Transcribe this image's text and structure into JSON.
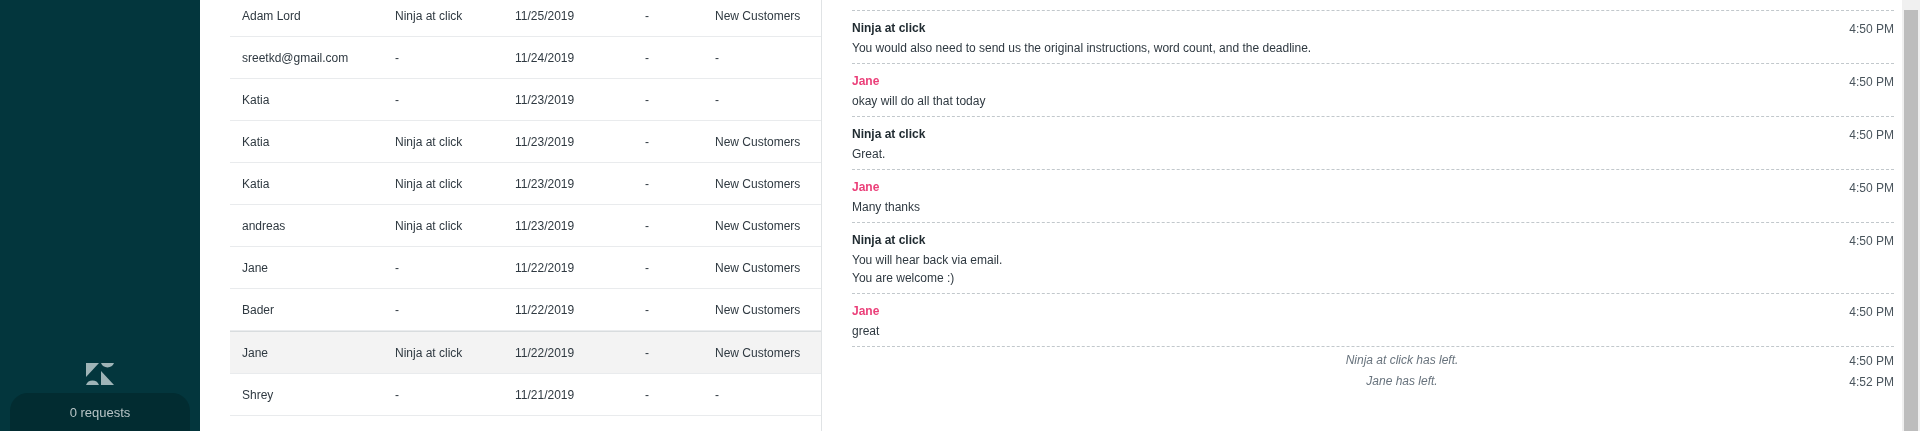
{
  "sidebar": {
    "requests_button": "0 requests"
  },
  "table": {
    "rows": [
      {
        "cells": [
          "Adam Lord",
          "Ninja at click",
          "11/25/2019",
          "-",
          "New Customers"
        ],
        "selected": false
      },
      {
        "cells": [
          "sreetkd@gmail.com",
          "-",
          "11/24/2019",
          "-",
          "-"
        ],
        "selected": false
      },
      {
        "cells": [
          "Katia",
          "-",
          "11/23/2019",
          "-",
          "-"
        ],
        "selected": false
      },
      {
        "cells": [
          "Katia",
          "Ninja at click",
          "11/23/2019",
          "-",
          "New Customers"
        ],
        "selected": false
      },
      {
        "cells": [
          "Katia",
          "Ninja at click",
          "11/23/2019",
          "-",
          "New Customers"
        ],
        "selected": false
      },
      {
        "cells": [
          "andreas",
          "Ninja at click",
          "11/23/2019",
          "-",
          "New Customers"
        ],
        "selected": false
      },
      {
        "cells": [
          "Jane",
          "-",
          "11/22/2019",
          "-",
          "New Customers"
        ],
        "selected": false
      },
      {
        "cells": [
          "Bader",
          "-",
          "11/22/2019",
          "-",
          "New Customers"
        ],
        "selected": false
      },
      {
        "cells": [
          "Jane",
          "Ninja at click",
          "11/22/2019",
          "-",
          "New Customers"
        ],
        "selected": true
      },
      {
        "cells": [
          "Shrey",
          "-",
          "11/21/2019",
          "-",
          "-"
        ],
        "selected": false
      }
    ]
  },
  "chat": {
    "entries": [
      {
        "kind": "message",
        "author": "Ninja at click",
        "color": "#1f2a30",
        "time": "4:50 PM",
        "lines": [
          "You would also need to send us the original instructions, word count, and the deadline."
        ]
      },
      {
        "kind": "message",
        "author": "Jane",
        "color": "#eb3f79",
        "time": "4:50 PM",
        "lines": [
          "okay will do all that today"
        ]
      },
      {
        "kind": "message",
        "author": "Ninja at click",
        "color": "#1f2a30",
        "time": "4:50 PM",
        "lines": [
          "Great."
        ]
      },
      {
        "kind": "message",
        "author": "Jane",
        "color": "#eb3f79",
        "time": "4:50 PM",
        "lines": [
          "Many thanks"
        ]
      },
      {
        "kind": "message",
        "author": "Ninja at click",
        "color": "#1f2a30",
        "time": "4:50 PM",
        "lines": [
          "You will hear back via email.",
          "You are welcome :)"
        ]
      },
      {
        "kind": "message",
        "author": "Jane",
        "color": "#eb3f79",
        "time": "4:50 PM",
        "lines": [
          "great"
        ]
      },
      {
        "kind": "system",
        "text": "Ninja at click has left.",
        "time": "4:50 PM"
      },
      {
        "kind": "system",
        "text": "Jane has left.",
        "time": "4:52 PM"
      }
    ]
  }
}
